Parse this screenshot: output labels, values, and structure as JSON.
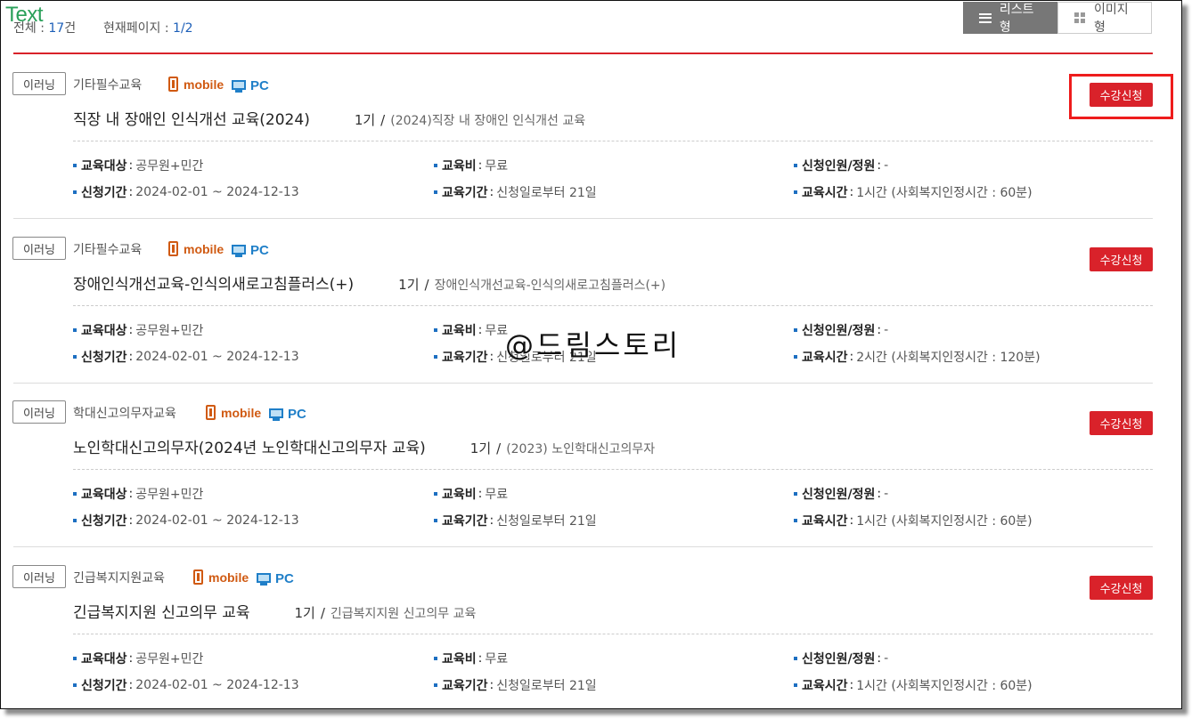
{
  "overlay": {
    "text": "Text"
  },
  "summary": {
    "total_label": "전체 :",
    "total_value": "17",
    "total_unit": "건",
    "page_label": "현재페이지 :",
    "page_value": "1/2"
  },
  "view_toggle": {
    "list_label": "리스트형",
    "image_label": "이미지형"
  },
  "watermark": "@드림스토리",
  "labels": {
    "target": "교육대상",
    "fee": "교육비",
    "capacity": "신청인원/정원",
    "apply_period": "신청기간",
    "edu_period": "교육기간",
    "edu_time": "교육시간",
    "mobile": "mobile",
    "pc": "PC",
    "apply_button": "수강신청",
    "slash": "/"
  },
  "courses": [
    {
      "type": "이러닝",
      "category": "기타필수교육",
      "title": "직장 내 장애인 인식개선 교육(2024)",
      "period": "1기",
      "subtitle": "(2024)직장 내 장애인 인식개선 교육",
      "target": "공무원+민간",
      "fee": "무료",
      "capacity": "-",
      "apply_period": "2024-02-01 ~ 2024-12-13",
      "edu_period": "신청일로부터 21일",
      "edu_time": "1시간 (사회복지인정시간 : 60분)"
    },
    {
      "type": "이러닝",
      "category": "기타필수교육",
      "title": "장애인식개선교육-인식의새로고침플러스(+)",
      "period": "1기",
      "subtitle": "장애인식개선교육-인식의새로고침플러스(+)",
      "target": "공무원+민간",
      "fee": "무료",
      "capacity": "-",
      "apply_period": "2024-02-01 ~ 2024-12-13",
      "edu_period": "신청일로부터 21일",
      "edu_time": "2시간 (사회복지인정시간 : 120분)"
    },
    {
      "type": "이러닝",
      "category": "학대신고의무자교육",
      "title": "노인학대신고의무자(2024년 노인학대신고의무자 교육)",
      "period": "1기",
      "subtitle": "(2023) 노인학대신고의무자",
      "target": "공무원+민간",
      "fee": "무료",
      "capacity": "-",
      "apply_period": "2024-02-01 ~ 2024-12-13",
      "edu_period": "신청일로부터 21일",
      "edu_time": "1시간 (사회복지인정시간 : 60분)"
    },
    {
      "type": "이러닝",
      "category": "긴급복지지원교육",
      "title": "긴급복지지원 신고의무 교육",
      "period": "1기",
      "subtitle": "긴급복지지원 신고의무 교육",
      "target": "공무원+민간",
      "fee": "무료",
      "capacity": "-",
      "apply_period": "2024-02-01 ~ 2024-12-13",
      "edu_period": "신청일로부터 21일",
      "edu_time": "1시간 (사회복지인정시간 : 60분)"
    }
  ]
}
